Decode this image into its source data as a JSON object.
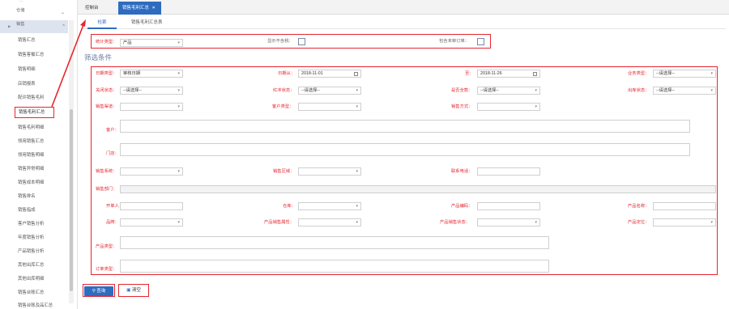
{
  "sidebar": {
    "top_label": "...",
    "groups": [
      {
        "label": "仓储",
        "chevron": "⌄"
      },
      {
        "label": "销售",
        "chevron": "^"
      }
    ],
    "items": [
      {
        "label": "销售汇总"
      },
      {
        "label": "销售客餐汇总"
      },
      {
        "label": "销售明细"
      },
      {
        "label": "店销报表"
      },
      {
        "label": "配许销售毛利"
      },
      {
        "label": "销售毛利汇总"
      },
      {
        "label": "销售毛利明细"
      },
      {
        "label": "领用销售汇总"
      },
      {
        "label": "领用销售明细"
      },
      {
        "label": "销售异常明细"
      },
      {
        "label": "销售成本明细"
      },
      {
        "label": "销售排名"
      },
      {
        "label": "销售指成"
      },
      {
        "label": "客户销售分析"
      },
      {
        "label": "年度销售分析"
      },
      {
        "label": "产品销售分析"
      },
      {
        "label": "其他出库汇总"
      },
      {
        "label": "其他出库明细"
      },
      {
        "label": "销售台账汇总"
      },
      {
        "label": "销售台账及品汇总"
      }
    ]
  },
  "tabs": [
    {
      "label": "控制台"
    },
    {
      "label": "销售毛利汇总",
      "close": "×"
    }
  ],
  "subtabs": [
    {
      "label": "检索"
    },
    {
      "label": "销售毛利汇总表"
    }
  ],
  "top_filters": {
    "stat_type_label": "统计类型：",
    "stat_type_value": "产品",
    "show_no_tax_label": "显示不含税：",
    "include_unaudited_label": "包含未审订单："
  },
  "filter_title": "筛选条件",
  "filters": {
    "date_type_label": "日期类型：",
    "date_type_value": "审核日期",
    "date_label": "日期从：",
    "date_from": "2018-11-01",
    "to_label": "至：",
    "date_to": "2018-11-26",
    "biz_type_label": "业务类型：",
    "biz_type_value": "--请选择--",
    "close_status_label": "关闭状态：",
    "close_status_value": "--请选择--",
    "red_status_label": "红冲状态：",
    "red_status_value": "--请选择--",
    "full_amount_label": "是否全款：",
    "full_amount_value": "--请选择--",
    "out_status_label": "出库状态：",
    "out_status_value": "--请选择--",
    "channel_label": "销售渠道：",
    "customer_type_label": "客户类型：",
    "sale_method_label": "销售方式：",
    "customer_label": "客户：",
    "store_label": "门店：",
    "system_label": "销售系统：",
    "region_label": "销售区域：",
    "phone_label": "联系电话：",
    "dept_label": "销售部门：",
    "opener_label": "开单人：",
    "warehouse_label": "仓库：",
    "product_code_label": "产品编码：",
    "product_name_label": "产品名称：",
    "brand_label": "品牌：",
    "product_attr_label": "产品销售属性：",
    "product_status_label": "产品销售状态：",
    "product_grade_label": "产品定位：",
    "product_type_label": "产品类型：",
    "order_type_label": "订单类型："
  },
  "buttons": {
    "query_label": "查询",
    "reset_label": "清空"
  },
  "colors": {
    "accent": "#2d6cc0",
    "highlight": "#e5262e"
  }
}
